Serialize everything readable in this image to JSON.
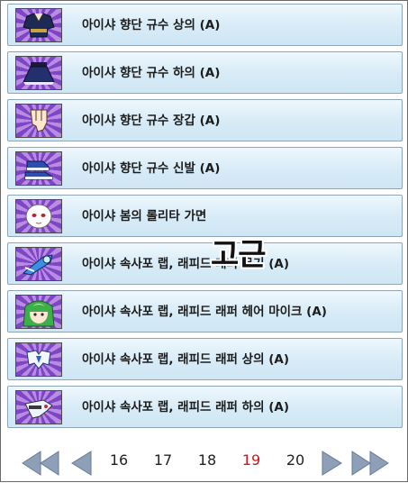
{
  "items": [
    {
      "label": "아이샤 향단 규수 상의 (A)",
      "icon": "blouse-icon"
    },
    {
      "label": "아이샤 향단 규수 하의 (A)",
      "icon": "skirt-icon"
    },
    {
      "label": "아이샤 향단 규수 장갑 (A)",
      "icon": "glove-icon"
    },
    {
      "label": "아이샤 향단 규수 신발 (A)",
      "icon": "shoes-icon"
    },
    {
      "label": "아이샤 봄의 롤리타 가면",
      "icon": "mask-icon"
    },
    {
      "label": "아이샤 속사포 랩, 래피드 래퍼 무기 (A)",
      "icon": "weapon-icon"
    },
    {
      "label": "아이샤 속사포 랩, 래피드 래퍼 헤어 마이크 (A)",
      "icon": "hair-icon"
    },
    {
      "label": "아이샤 속사포 랩, 래피드 래퍼 상의 (A)",
      "icon": "top-icon"
    },
    {
      "label": "아이샤 속사포 랩, 래피드 래퍼 하의 (A)",
      "icon": "bottom-icon"
    }
  ],
  "overlay_text": "고근",
  "pager": {
    "pages": [
      "16",
      "17",
      "18",
      "19",
      "20"
    ],
    "current": "19"
  },
  "colors": {
    "row_bg": "#d7ebf7",
    "icon_purple": "#7e45c5",
    "active_page": "#d2141e",
    "arrow": "#8e9fb8"
  }
}
